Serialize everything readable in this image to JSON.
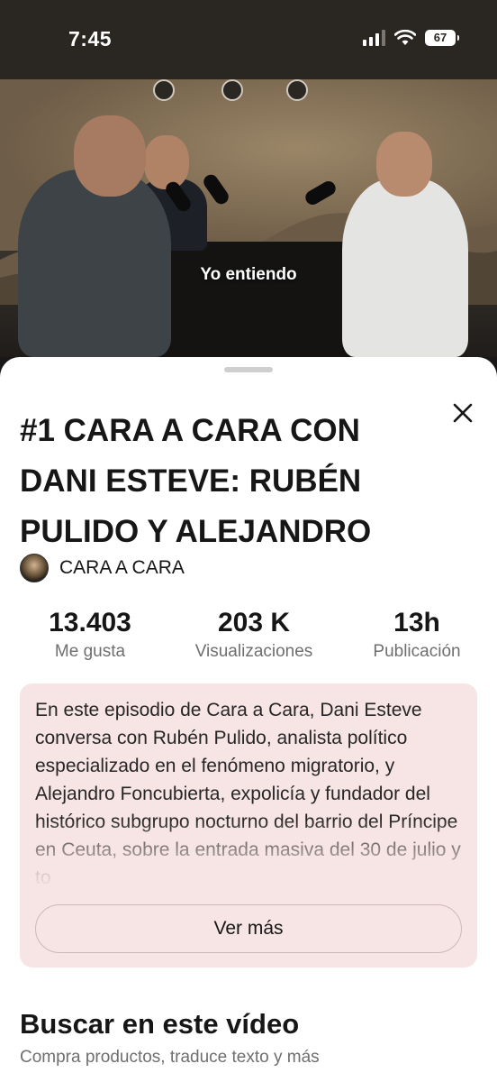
{
  "status_bar": {
    "time": "7:45",
    "battery": "67",
    "icons": [
      "signal-icon",
      "wifi-icon",
      "battery-icon"
    ]
  },
  "video": {
    "subtitle": "Yo entiendo"
  },
  "sheet": {
    "title": "#1 CARA A CARA CON DANI ESTEVE: RUBÉN PULIDO Y ALEJANDRO",
    "close_icon": "close-icon",
    "channel": {
      "name": "CARA A CARA"
    },
    "stats": [
      {
        "value": "13.403",
        "label": "Me gusta"
      },
      {
        "value": "203 K",
        "label": "Visualizaciones"
      },
      {
        "value": "13h",
        "label": "Publicación"
      }
    ],
    "description": "En este episodio de Cara a Cara, Dani Esteve conversa con Rubén Pulido, analista político especializado en el fenómeno migratorio, y Alejandro Foncubierta, expolicía y fundador del histórico subgrupo nocturno del barrio del Príncipe en Ceuta, sobre la entrada masiva del 30 de julio y to",
    "more_button": "Ver más",
    "search_section": {
      "title": "Buscar en este vídeo",
      "subtitle": "Compra productos, traduce texto y más"
    }
  }
}
